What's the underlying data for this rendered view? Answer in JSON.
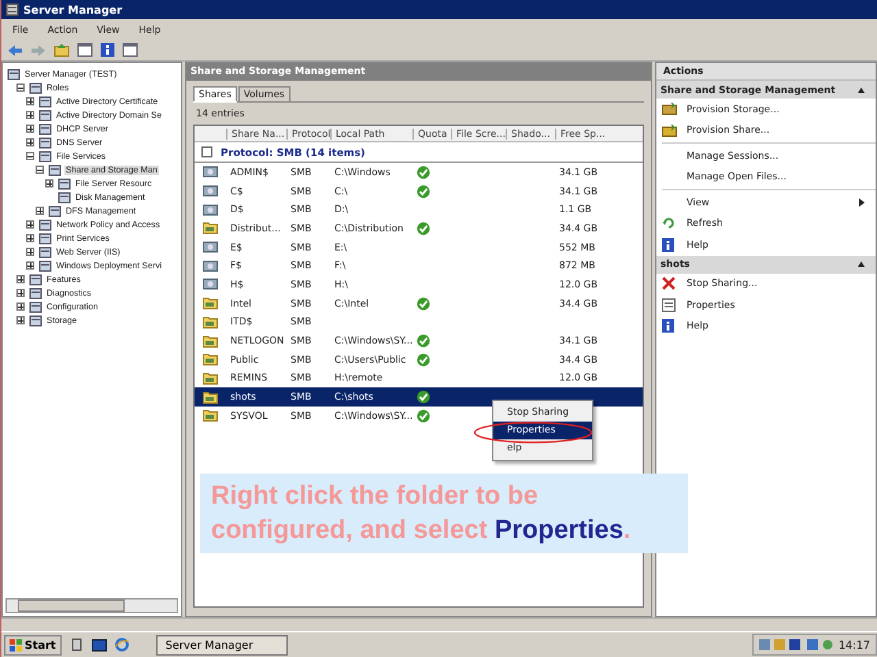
{
  "window": {
    "title": "Server Manager"
  },
  "menu": [
    "File",
    "Action",
    "View",
    "Help"
  ],
  "tree": [
    {
      "label": "Server Manager (TEST)",
      "selected": false,
      "children": [
        {
          "label": "Roles",
          "expanded": true,
          "selected": false,
          "children": [
            {
              "label": "Active Directory Certificate",
              "expanded": false,
              "selected": false
            },
            {
              "label": "Active Directory Domain Se",
              "expanded": false,
              "selected": false
            },
            {
              "label": "DHCP Server",
              "expanded": false,
              "selected": false
            },
            {
              "label": "DNS Server",
              "expanded": false,
              "selected": false
            },
            {
              "label": "File Services",
              "expanded": true,
              "selected": false,
              "children": [
                {
                  "label": "Share and Storage Man",
                  "expanded": true,
                  "selected": true,
                  "children": [
                    {
                      "label": "File Server Resourc",
                      "expanded": false,
                      "selected": false
                    },
                    {
                      "label": "Disk Management",
                      "selected": false
                    }
                  ]
                },
                {
                  "label": "DFS Management",
                  "expanded": false,
                  "selected": false
                }
              ]
            },
            {
              "label": "Network Policy and Access",
              "expanded": false,
              "selected": false
            },
            {
              "label": "Print Services",
              "expanded": false,
              "selected": false
            },
            {
              "label": "Web Server (IIS)",
              "expanded": false,
              "selected": false
            },
            {
              "label": "Windows Deployment Servi",
              "expanded": false,
              "selected": false
            }
          ]
        },
        {
          "label": "Features",
          "expanded": false,
          "selected": false
        },
        {
          "label": "Diagnostics",
          "expanded": false,
          "selected": false
        },
        {
          "label": "Configuration",
          "expanded": false,
          "selected": false
        },
        {
          "label": "Storage",
          "expanded": false,
          "selected": false
        }
      ]
    }
  ],
  "center": {
    "title": "Share and Storage Management",
    "tabs": [
      {
        "label": "Shares",
        "selected": true
      },
      {
        "label": "Volumes",
        "selected": false
      }
    ],
    "count": "14 entries",
    "columns": [
      "Share Na...",
      "Protocol",
      "Local Path",
      "Quota",
      "File Scre...",
      "Shado...",
      "Free Sp..."
    ],
    "group": "Protocol: SMB (14 items)",
    "rows": [
      {
        "kind": "admin_share",
        "name": "ADMIN$",
        "protocol": "SMB",
        "path": "C:\\Windows",
        "quota": true,
        "free": "34.1 GB",
        "selected": false
      },
      {
        "kind": "admin_share",
        "name": "C$",
        "protocol": "SMB",
        "path": "C:\\",
        "quota": true,
        "free": "34.1 GB",
        "selected": false
      },
      {
        "kind": "admin_share",
        "name": "D$",
        "protocol": "SMB",
        "path": "D:\\",
        "quota": false,
        "free": "1.1 GB",
        "selected": false
      },
      {
        "kind": "folder",
        "name": "Distribut...",
        "protocol": "SMB",
        "path": "C:\\Distribution",
        "quota": true,
        "free": "34.4 GB",
        "selected": false
      },
      {
        "kind": "admin_share",
        "name": "E$",
        "protocol": "SMB",
        "path": "E:\\",
        "quota": false,
        "free": "552 MB",
        "selected": false
      },
      {
        "kind": "admin_share",
        "name": "F$",
        "protocol": "SMB",
        "path": "F:\\",
        "quota": false,
        "free": "872 MB",
        "selected": false
      },
      {
        "kind": "admin_share",
        "name": "H$",
        "protocol": "SMB",
        "path": "H:\\",
        "quota": false,
        "free": "12.0 GB",
        "selected": false
      },
      {
        "kind": "folder",
        "name": "Intel",
        "protocol": "SMB",
        "path": "C:\\Intel",
        "quota": true,
        "free": "34.4 GB",
        "selected": false
      },
      {
        "kind": "folder",
        "name": "ITD$",
        "protocol": "SMB",
        "quota": false,
        "selected": false
      },
      {
        "kind": "folder",
        "name": "NETLOGON",
        "protocol": "SMB",
        "path": "C:\\Windows\\SY...",
        "quota": true,
        "free": "34.1 GB",
        "selected": false
      },
      {
        "kind": "folder",
        "name": "Public",
        "protocol": "SMB",
        "path": "C:\\Users\\Public",
        "quota": true,
        "free": "34.4 GB",
        "selected": false
      },
      {
        "kind": "folder",
        "name": "REMINS",
        "protocol": "SMB",
        "path": "H:\\remote",
        "quota": false,
        "free": "12.0 GB",
        "selected": false
      },
      {
        "kind": "folder",
        "name": "shots",
        "protocol": "SMB",
        "path": "C:\\shots",
        "quota": true,
        "selected": true
      },
      {
        "kind": "folder",
        "name": "SYSVOL",
        "protocol": "SMB",
        "path": "C:\\Windows\\SY...",
        "quota": true,
        "selected": false
      }
    ]
  },
  "context_menu": [
    {
      "label": "Stop Sharing",
      "selected": false
    },
    {
      "label": "Properties",
      "selected": true
    },
    {
      "label": "elp",
      "selected": false
    }
  ],
  "caption": {
    "before": "Right click the folder to be configured, and select ",
    "highlight": "Properties",
    "after": "."
  },
  "actions": {
    "title": "Actions",
    "sections": [
      {
        "title": "Share and Storage Management",
        "items": [
          {
            "kind": "storage",
            "label": "Provision Storage..."
          },
          {
            "kind": "share",
            "label": "Provision Share..."
          },
          {
            "kind": "divider"
          },
          {
            "kind": "plain",
            "label": "Manage Sessions..."
          },
          {
            "kind": "plain",
            "label": "Manage Open Files..."
          },
          {
            "kind": "divider"
          },
          {
            "kind": "submenu",
            "label": "View"
          },
          {
            "kind": "refresh",
            "label": "Refresh"
          },
          {
            "kind": "help",
            "label": "Help"
          }
        ]
      },
      {
        "title": "shots",
        "items": [
          {
            "kind": "stop",
            "label": "Stop Sharing..."
          },
          {
            "kind": "properties",
            "label": "Properties"
          },
          {
            "kind": "help",
            "label": "Help"
          }
        ]
      }
    ]
  },
  "taskbar": {
    "start": "Start",
    "tasks": [
      "Server Manager"
    ],
    "clock": "14:17"
  }
}
